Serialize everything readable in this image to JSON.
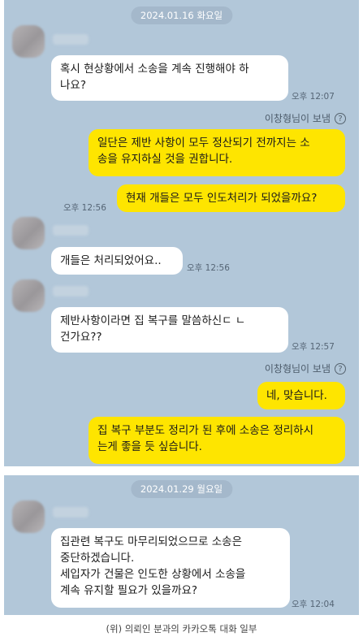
{
  "section1": {
    "date": "2024.01.16 화요일",
    "messages": [
      {
        "text": "혹시 현상황에서 소송을 계속 진행해야 하\n나요?",
        "time": "오후 12:07"
      },
      {
        "sender_note": "이창형님이 보냄",
        "help_icon": "question-circle-icon"
      },
      {
        "text": "일단은 제반 사항이 모두 정산되기 전까지는 소\n송을 유지하실 것을 권합니다."
      },
      {
        "text": "현재 개들은 모두 인도처리가 되었을까요?",
        "time": "오후 12:56"
      },
      {
        "text": "개들은 처리되었어요..",
        "time": "오후 12:56"
      },
      {
        "text": "제반사항이라면 집 복구를 말씀하신ㄷ ㄴ\n건가요??",
        "time": "오후 12:57"
      },
      {
        "sender_note": "이창형님이 보냄",
        "help_icon": "question-circle-icon"
      },
      {
        "text": "네, 맞습니다."
      },
      {
        "text": "집 복구 부분도 정리가 된 후에 소송은 정리하시\n는게 좋을 듯 싶습니다."
      }
    ]
  },
  "section2": {
    "date": "2024.01.29 월요일",
    "messages": [
      {
        "text": "집관련 복구도 마무리되었으므로 소송은\n중단하겠습니다.\n세입자가 건물은 인도한 상황에서 소송을\n계속 유지할 필요가 있을까요?",
        "time": "오후 12:04"
      }
    ]
  },
  "caption": "(위) 의뢰인 분과의 카카오톡 대화 일부",
  "colors": {
    "chat_bg": "#b2c7d9",
    "my_bubble": "#fee500",
    "other_bubble": "#ffffff"
  }
}
